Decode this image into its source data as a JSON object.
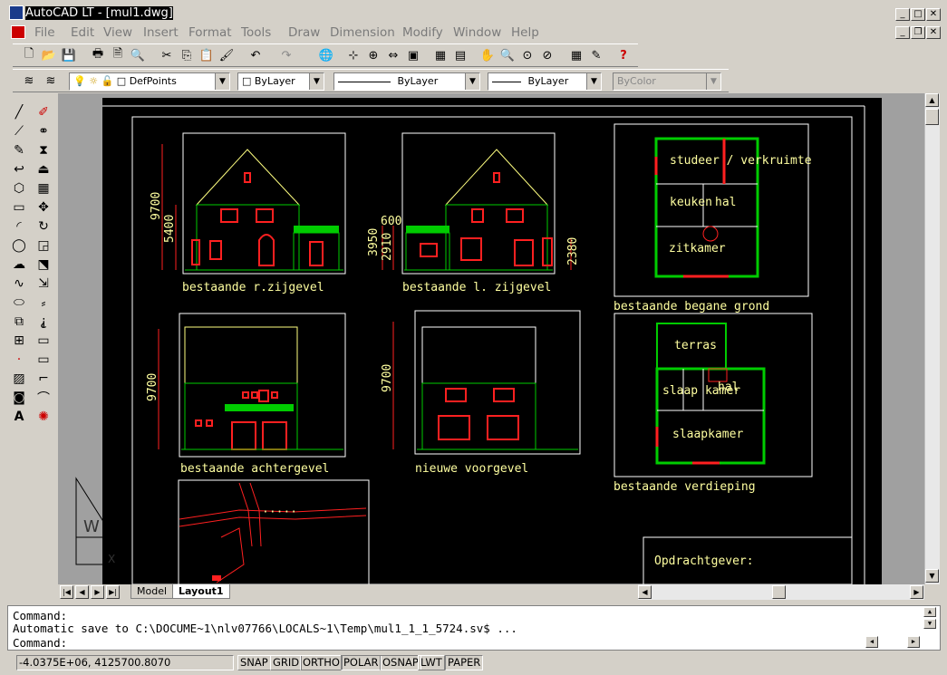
{
  "window": {
    "title": "AutoCAD LT - [mul1.dwg]"
  },
  "menu": {
    "items": [
      "File",
      "Edit",
      "View",
      "Insert",
      "Format",
      "Tools",
      "Draw",
      "Dimension",
      "Modify",
      "Window",
      "Help"
    ]
  },
  "layers_toolbar": {
    "layer": "DefPoints",
    "color": "ByLayer",
    "linetype": "ByLayer",
    "lineweight": "ByLayer",
    "plotstyle": "ByColor"
  },
  "drawing": {
    "labels": {
      "r_zijgevel": "bestaande r.zijgevel",
      "l_zijgevel": "bestaande l. zijgevel",
      "begane_grond": "bestaande begane grond",
      "achtergevel": "bestaande achtergevel",
      "voorgevel": "nieuwe voorgevel",
      "verdieping": "bestaande verdieping"
    },
    "dims": {
      "d9700": "9700",
      "d5400": "5400",
      "d600": "600",
      "d3950": "3950",
      "d2910": "2910",
      "d2380": "2380"
    },
    "rooms": {
      "studeer": "studeer / verkruimte",
      "keuken": "keuken",
      "hal": "hal",
      "zitkamer": "zitkamer",
      "terras": "terras",
      "slaap": "slaap kamer",
      "slaapkamer": "slaapkamer"
    },
    "titleblock": "Opdrachtgever:"
  },
  "tabs": {
    "model": "Model",
    "layout": "Layout1"
  },
  "command": {
    "line1": "Command:",
    "line2": "Automatic save to C:\\DOCUME~1\\nlv07766\\LOCALS~1\\Temp\\mul1_1_1_5724.sv$ ...",
    "line3": "Command:"
  },
  "status": {
    "coords": "-4.0375E+06, 4125700.8070",
    "buttons": [
      "SNAP",
      "GRID",
      "ORTHO",
      "POLAR",
      "OSNAP",
      "LWT",
      "PAPER"
    ]
  },
  "colors": {
    "paper_bg": "#000000",
    "outline": "#ffffff",
    "wall": "#00cc00",
    "window": "#ff2020",
    "text": "#ffffa0"
  }
}
